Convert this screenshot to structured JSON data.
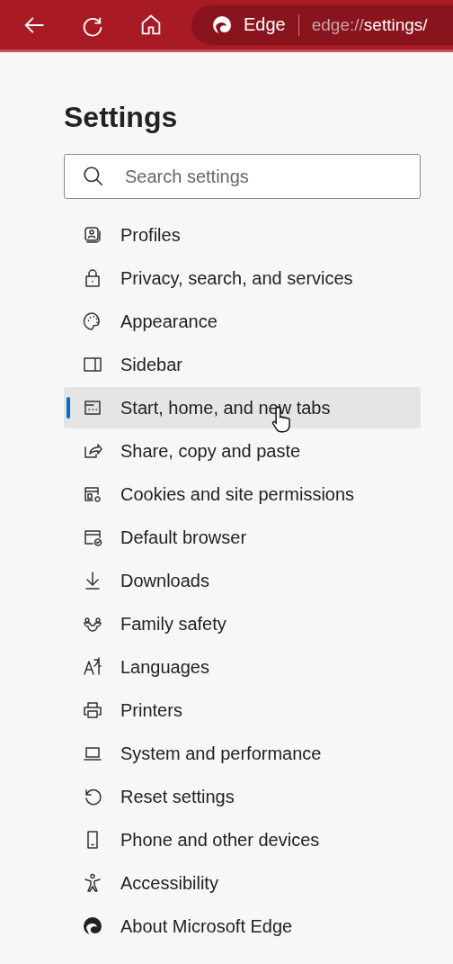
{
  "toolbar": {
    "site_name": "Edge",
    "url_scheme": "edge://",
    "url_path": "settings/"
  },
  "title": "Settings",
  "search": {
    "placeholder": "Search settings"
  },
  "nav": [
    {
      "label": "Profiles",
      "selected": false
    },
    {
      "label": "Privacy, search, and services",
      "selected": false
    },
    {
      "label": "Appearance",
      "selected": false
    },
    {
      "label": "Sidebar",
      "selected": false
    },
    {
      "label": "Start, home, and new tabs",
      "selected": true
    },
    {
      "label": "Share, copy and paste",
      "selected": false
    },
    {
      "label": "Cookies and site permissions",
      "selected": false
    },
    {
      "label": "Default browser",
      "selected": false
    },
    {
      "label": "Downloads",
      "selected": false
    },
    {
      "label": "Family safety",
      "selected": false
    },
    {
      "label": "Languages",
      "selected": false
    },
    {
      "label": "Printers",
      "selected": false
    },
    {
      "label": "System and performance",
      "selected": false
    },
    {
      "label": "Reset settings",
      "selected": false
    },
    {
      "label": "Phone and other devices",
      "selected": false
    },
    {
      "label": "Accessibility",
      "selected": false
    },
    {
      "label": "About Microsoft Edge",
      "selected": false
    }
  ]
}
